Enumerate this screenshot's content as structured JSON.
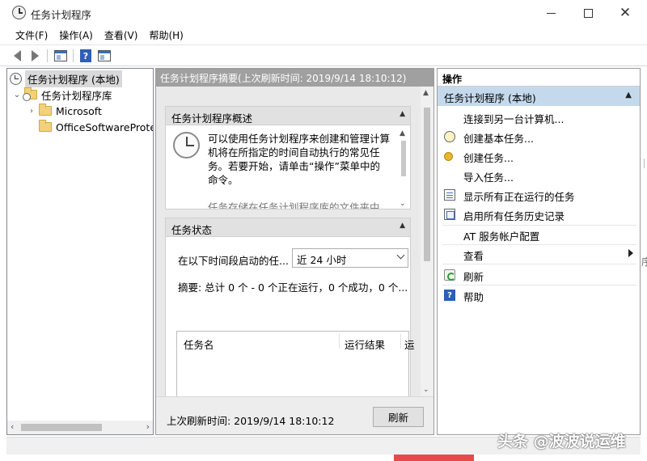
{
  "window": {
    "title": "任务计划程序"
  },
  "menu": [
    "文件(F)",
    "操作(A)",
    "查看(V)",
    "帮助(H)"
  ],
  "toolbar": {
    "help_glyph": "?"
  },
  "tree": {
    "root": "任务计划程序 (本地)",
    "library": "任务计划程序库",
    "children": [
      "Microsoft",
      "OfficeSoftwareProte"
    ]
  },
  "middle": {
    "header": "任务计划程序摘要(上次刷新时间: 2019/9/14 18:10:12)",
    "overview": {
      "title": "任务计划程序概述",
      "lines": [
        "可以使用任务计划程序来创建和管理计算",
        "机将在所指定的时间自动执行的常见任",
        "务。若要开始，请单击“操作”菜单中的",
        "命令。"
      ],
      "faded_line": "任务存储在任务计划程序库的文件夹中"
    },
    "status": {
      "title": "任务状态",
      "filter_label": "在以下时间段启动的任...",
      "filter_value": "近 24 小时",
      "summary": "摘要: 总计 0 个 - 0 个正在运行，0 个成功，0 个...",
      "columns": [
        "任务名",
        "运行结果",
        "运"
      ]
    },
    "footer": {
      "last_refresh": "上次刷新时间: 2019/9/14 18:10:12",
      "refresh_button": "刷新"
    }
  },
  "actions": {
    "header": "操作",
    "section": "任务计划程序 (本地)",
    "items": [
      {
        "label": "连接到另一台计算机...",
        "icon": "none"
      },
      {
        "label": "创建基本任务...",
        "icon": "clock-plus-icon"
      },
      {
        "label": "创建任务...",
        "icon": "sun-task-icon"
      },
      {
        "label": "导入任务...",
        "icon": "none"
      },
      {
        "label": "显示所有正在运行的任务",
        "icon": "running-list-icon"
      },
      {
        "label": "启用所有任务历史记录",
        "icon": "history-icon"
      },
      {
        "label": "AT 服务帐户配置",
        "icon": "none"
      },
      {
        "label": "查看",
        "icon": "none"
      },
      {
        "label": "刷新",
        "icon": "refresh-icon"
      },
      {
        "label": "帮助",
        "icon": "help-icon"
      }
    ]
  },
  "edge_fragment": "序",
  "watermark": "头条 @波波说运维",
  "colors": {
    "accent_selected": "#c5d9ec",
    "header_gray": "#a0a0a0",
    "help_blue": "#2d5fb8"
  }
}
